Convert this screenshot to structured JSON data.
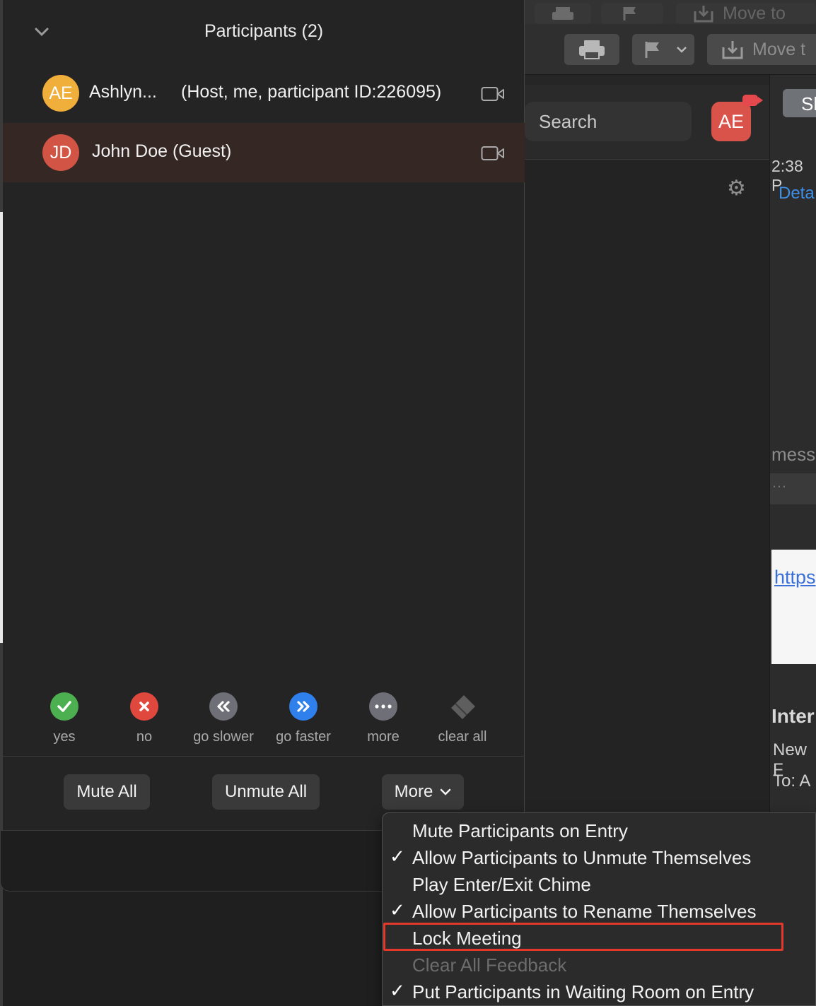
{
  "panel": {
    "title": "Participants (2)",
    "participants": [
      {
        "initials": "AE",
        "name": "Ashlyn...",
        "extra": "(Host, me, participant ID:226095)",
        "avatar_color": "#f0ae3a"
      },
      {
        "initials": "JD",
        "name": "John Doe (Guest)",
        "extra": "",
        "avatar_color": "#d25444"
      }
    ],
    "reactions": [
      {
        "label": "yes",
        "color": "#4caf50",
        "icon": "check-icon"
      },
      {
        "label": "no",
        "color": "#e0483d",
        "icon": "x-icon"
      },
      {
        "label": "go slower",
        "color": "#6f6f78",
        "icon": "rewind-icon"
      },
      {
        "label": "go faster",
        "color": "#2f80ed",
        "icon": "fast-forward-icon"
      },
      {
        "label": "more",
        "color": "#6f6f78",
        "icon": "ellipsis-icon"
      },
      {
        "label": "clear all",
        "color": "#6f6f6f",
        "icon": "eraser-icon"
      }
    ],
    "buttons": {
      "mute_all": "Mute All",
      "unmute_all": "Unmute All",
      "more": "More"
    }
  },
  "menu": {
    "items": [
      {
        "label": "Mute Participants on Entry",
        "checked": false,
        "disabled": false
      },
      {
        "label": "Allow Participants to Unmute Themselves",
        "checked": true,
        "disabled": false
      },
      {
        "label": "Play Enter/Exit Chime",
        "checked": false,
        "disabled": false
      },
      {
        "label": "Allow Participants to Rename Themselves",
        "checked": true,
        "disabled": false
      },
      {
        "label": "Lock Meeting",
        "checked": false,
        "disabled": false,
        "highlighted": true
      },
      {
        "label": "Clear All Feedback",
        "checked": false,
        "disabled": true
      },
      {
        "label": "Put Participants in Waiting Room on Entry",
        "checked": true,
        "disabled": false
      }
    ],
    "check_glyph": "✓",
    "highlight_color": "#e2392c"
  },
  "background": {
    "toolbar": {
      "move_to_top": "Move to",
      "move_to": "Move t"
    },
    "zoom": {
      "search_placeholder": "Search",
      "avatar_initials": "AE"
    },
    "mail": {
      "show_button": "Sh",
      "time": "2:38 P",
      "details_link": "Deta",
      "message_partial": "messa",
      "dots": "…",
      "link_partial": "https",
      "subject_partial": "Inter",
      "from_partial": "New F",
      "to_partial": "To:  A"
    }
  }
}
